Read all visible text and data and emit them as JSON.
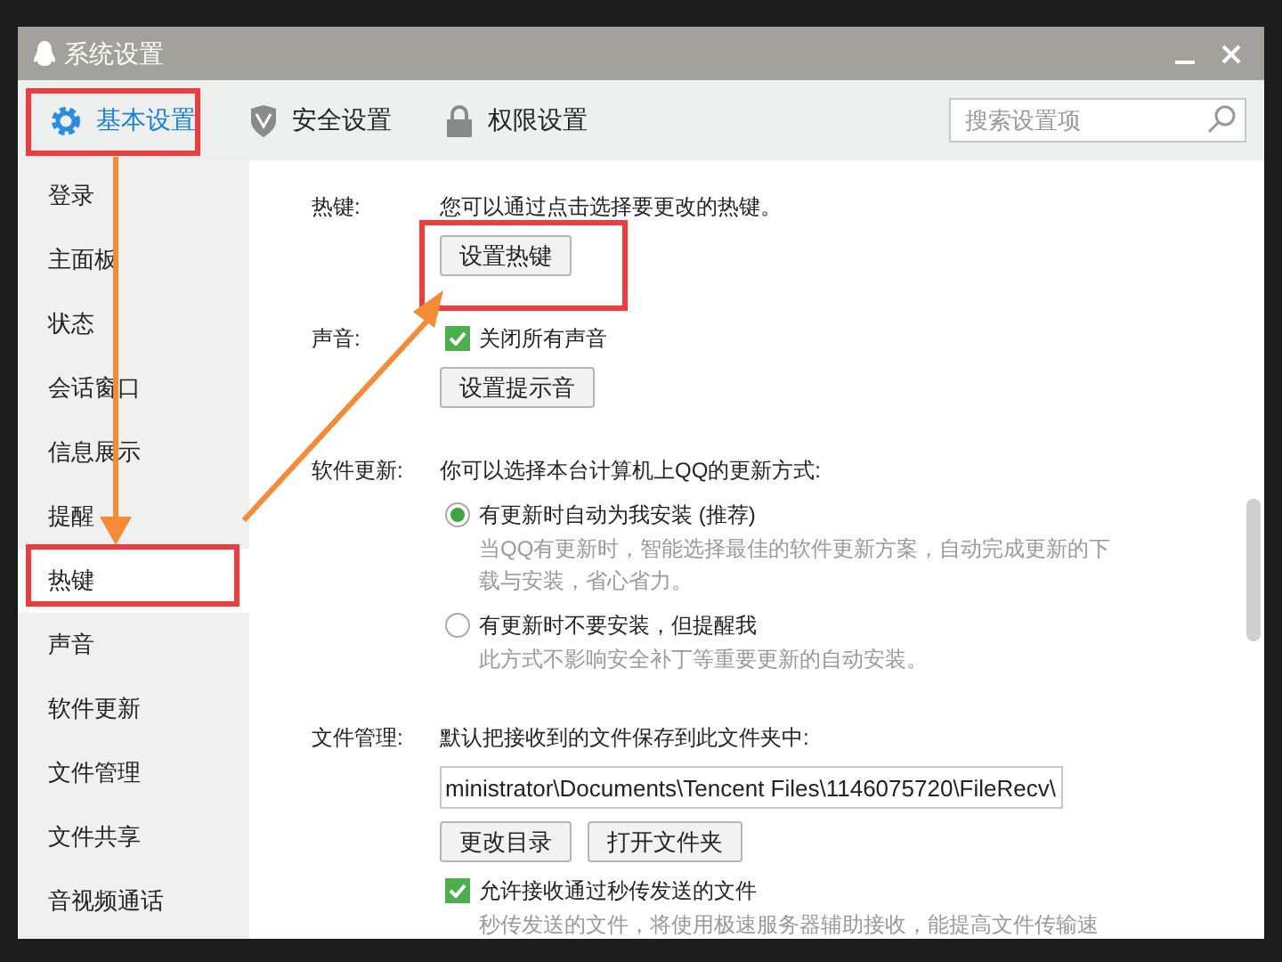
{
  "window": {
    "title": "系统设置"
  },
  "tabs": [
    {
      "label": "基本设置",
      "selected": true
    },
    {
      "label": "安全设置",
      "selected": false
    },
    {
      "label": "权限设置",
      "selected": false
    }
  ],
  "search": {
    "placeholder": "搜索设置项"
  },
  "sidebar": {
    "items": [
      {
        "label": "登录",
        "selected": false
      },
      {
        "label": "主面板",
        "selected": false
      },
      {
        "label": "状态",
        "selected": false
      },
      {
        "label": "会话窗口",
        "selected": false
      },
      {
        "label": "信息展示",
        "selected": false
      },
      {
        "label": "提醒",
        "selected": false
      },
      {
        "label": "热键",
        "selected": true
      },
      {
        "label": "声音",
        "selected": false
      },
      {
        "label": "软件更新",
        "selected": false
      },
      {
        "label": "文件管理",
        "selected": false
      },
      {
        "label": "文件共享",
        "selected": false
      },
      {
        "label": "音视频通话",
        "selected": false
      }
    ]
  },
  "sections": [
    {
      "label": "热键:",
      "items": [
        {
          "kind": "text",
          "text": "您可以通过点击选择要更改的热键。"
        },
        {
          "kind": "buttons",
          "buttons": [
            "设置热键"
          ]
        }
      ]
    },
    {
      "label": "声音:",
      "items": [
        {
          "kind": "checkbox",
          "text": "关闭所有声音",
          "checked": true
        },
        {
          "kind": "buttons",
          "buttons": [
            "设置提示音"
          ]
        }
      ]
    },
    {
      "label": "软件更新:",
      "items": [
        {
          "kind": "text",
          "text": "你可以选择本台计算机上QQ的更新方式:"
        },
        {
          "kind": "radio",
          "text": "有更新时自动为我安装 (推荐)",
          "selected": true
        },
        {
          "kind": "hint",
          "text": "当QQ有更新时，智能选择最佳的软件更新方案，自动完成更新的下载与安装，省心省力。"
        },
        {
          "kind": "radio",
          "text": "有更新时不要安装，但提醒我",
          "selected": false
        },
        {
          "kind": "hint",
          "text": "此方式不影响安全补丁等重要更新的自动安装。"
        }
      ]
    },
    {
      "label": "文件管理:",
      "items": [
        {
          "kind": "text",
          "text": "默认把接收到的文件保存到此文件夹中:"
        },
        {
          "kind": "field",
          "value": "ministrator\\Documents\\Tencent Files\\1146075720\\FileRecv\\"
        },
        {
          "kind": "buttons",
          "buttons": [
            "更改目录",
            "打开文件夹"
          ]
        },
        {
          "kind": "checkbox",
          "text": "允许接收通过秒传发送的文件",
          "checked": true
        },
        {
          "kind": "hint",
          "text": "秒传发送的文件，将使用极速服务器辅助接收，能提高文件传输速"
        }
      ]
    }
  ]
}
